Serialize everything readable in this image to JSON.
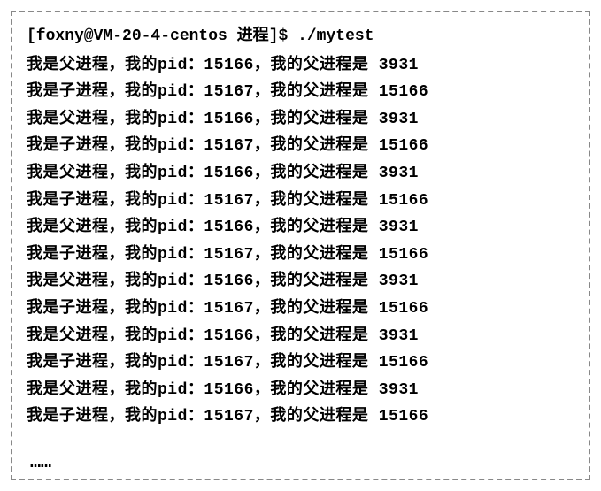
{
  "prompt": {
    "user_host": "[foxny@VM-20-4-centos 进程]$",
    "command": "./mytest"
  },
  "output_template": {
    "parent_prefix": "我是父进程，我的pid：",
    "child_prefix": "我是子进程，我的pid：",
    "middle": "，我的父进程是 "
  },
  "lines": [
    {
      "type": "parent",
      "pid": "15166",
      "ppid": "3931"
    },
    {
      "type": "child",
      "pid": "15167",
      "ppid": "15166"
    },
    {
      "type": "parent",
      "pid": "15166",
      "ppid": "3931"
    },
    {
      "type": "child",
      "pid": "15167",
      "ppid": "15166"
    },
    {
      "type": "parent",
      "pid": "15166",
      "ppid": "3931"
    },
    {
      "type": "child",
      "pid": "15167",
      "ppid": "15166"
    },
    {
      "type": "parent",
      "pid": "15166",
      "ppid": "3931"
    },
    {
      "type": "child",
      "pid": "15167",
      "ppid": "15166"
    },
    {
      "type": "parent",
      "pid": "15166",
      "ppid": "3931"
    },
    {
      "type": "child",
      "pid": "15167",
      "ppid": "15166"
    },
    {
      "type": "parent",
      "pid": "15166",
      "ppid": "3931"
    },
    {
      "type": "child",
      "pid": "15167",
      "ppid": "15166"
    },
    {
      "type": "parent",
      "pid": "15166",
      "ppid": "3931"
    },
    {
      "type": "child",
      "pid": "15167",
      "ppid": "15166"
    }
  ],
  "ellipsis": "……"
}
